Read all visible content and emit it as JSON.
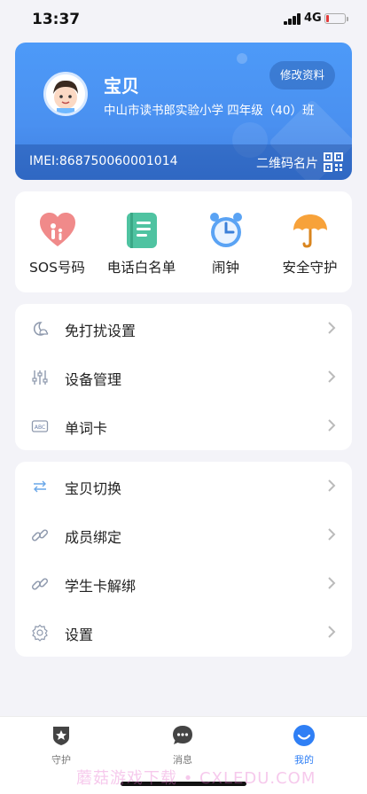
{
  "status_bar": {
    "time": "13:37",
    "network": "4G",
    "battery_level": 0.15
  },
  "profile": {
    "name": "宝贝",
    "school": "中山市读书郎实验小学 四年级（40）班",
    "edit_label": "修改资料",
    "imei": "IMEI:868750060001014",
    "qr_label": "二维码名片",
    "card_color": "#4a90f0"
  },
  "quick_actions": [
    {
      "label": "SOS号码",
      "icon": "heart-family-icon"
    },
    {
      "label": "电话白名单",
      "icon": "phonebook-icon"
    },
    {
      "label": "闹钟",
      "icon": "alarm-clock-icon"
    },
    {
      "label": "安全守护",
      "icon": "umbrella-icon"
    }
  ],
  "menu_group_1": [
    {
      "label": "免打扰设置",
      "icon": "moon-cloud-icon"
    },
    {
      "label": "设备管理",
      "icon": "sliders-icon"
    },
    {
      "label": "单词卡",
      "icon": "abc-card-icon"
    }
  ],
  "menu_group_2": [
    {
      "label": "宝贝切换",
      "icon": "swap-arrows-icon"
    },
    {
      "label": "成员绑定",
      "icon": "link-icon"
    },
    {
      "label": "学生卡解绑",
      "icon": "unlink-icon"
    },
    {
      "label": "设置",
      "icon": "gear-icon"
    }
  ],
  "tab_bar": [
    {
      "label": "守护",
      "icon": "shield-star-icon"
    },
    {
      "label": "消息",
      "icon": "chat-bubble-icon"
    },
    {
      "label": "我的",
      "icon": "profile-smile-icon",
      "active": true
    }
  ],
  "watermark": "蘑菇游戏下载 • CXLEDU.COM",
  "accent_color": "#2f7ff5"
}
